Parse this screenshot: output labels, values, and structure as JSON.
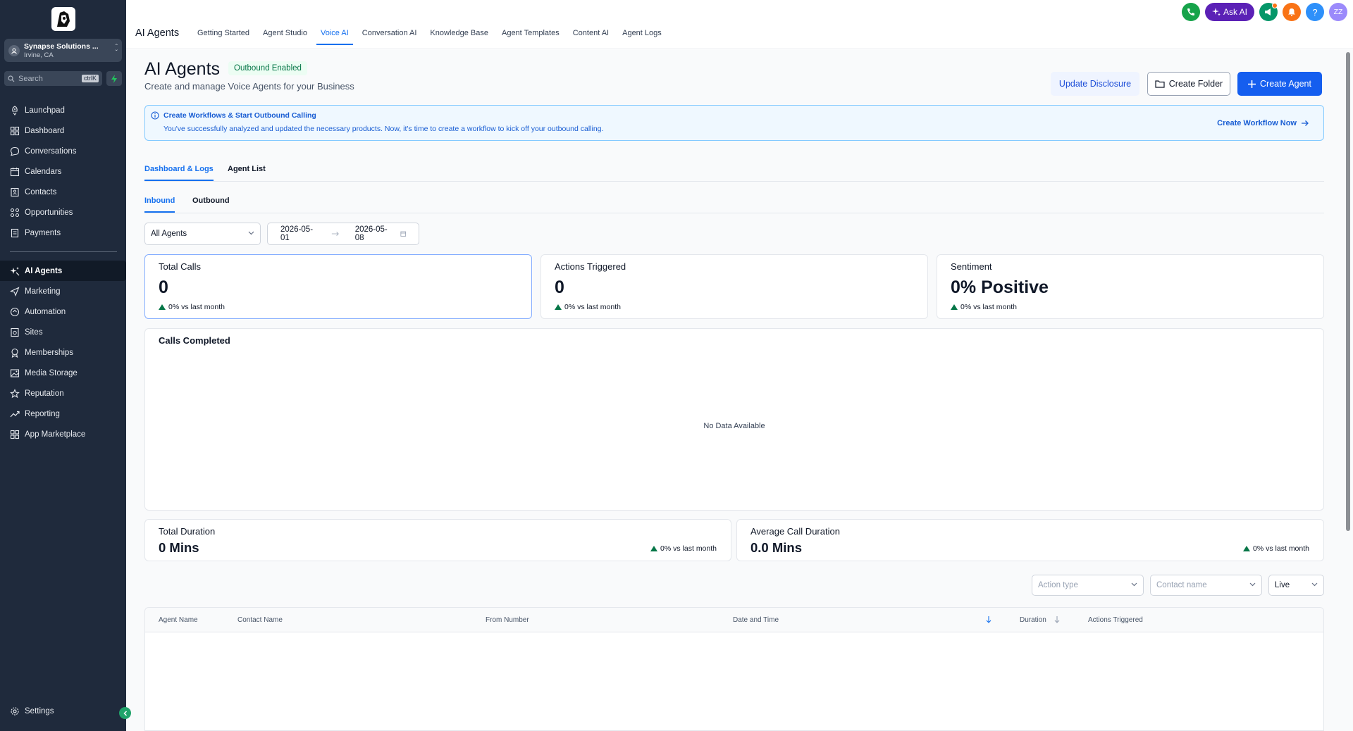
{
  "sidebar": {
    "account": {
      "name": "Synapse Solutions ...",
      "location": "Irvine, CA"
    },
    "search": {
      "placeholder": "Search",
      "shortcut": "ctrlK"
    },
    "items_top": [
      {
        "label": "Launchpad",
        "icon": "rocket-icon"
      },
      {
        "label": "Dashboard",
        "icon": "grid-icon"
      },
      {
        "label": "Conversations",
        "icon": "chat-icon"
      },
      {
        "label": "Calendars",
        "icon": "calendar-icon"
      },
      {
        "label": "Contacts",
        "icon": "contacts-icon"
      },
      {
        "label": "Opportunities",
        "icon": "opportunities-icon"
      },
      {
        "label": "Payments",
        "icon": "payments-icon"
      }
    ],
    "items_bottom": [
      {
        "label": "AI Agents",
        "icon": "sparkle-icon",
        "active": true
      },
      {
        "label": "Marketing",
        "icon": "send-icon"
      },
      {
        "label": "Automation",
        "icon": "automation-icon"
      },
      {
        "label": "Sites",
        "icon": "sites-icon"
      },
      {
        "label": "Memberships",
        "icon": "badge-icon"
      },
      {
        "label": "Media Storage",
        "icon": "image-icon"
      },
      {
        "label": "Reputation",
        "icon": "star-icon"
      },
      {
        "label": "Reporting",
        "icon": "trend-icon"
      },
      {
        "label": "App Marketplace",
        "icon": "apps-icon"
      }
    ],
    "settings": "Settings"
  },
  "topbar": {
    "title": "AI Agents",
    "tabs": [
      {
        "label": "Getting Started"
      },
      {
        "label": "Agent Studio"
      },
      {
        "label": "Voice AI",
        "active": true
      },
      {
        "label": "Conversation AI"
      },
      {
        "label": "Knowledge Base"
      },
      {
        "label": "Agent Templates"
      },
      {
        "label": "Content AI"
      },
      {
        "label": "Agent Logs"
      }
    ],
    "ask_ai": "Ask AI",
    "avatar": "ZZ",
    "help": "?"
  },
  "page": {
    "title": "AI Agents",
    "badge": "Outbound Enabled",
    "subtitle": "Create and manage Voice Agents for your Business",
    "btn_update": "Update Disclosure",
    "btn_folder": "Create Folder",
    "btn_create": "Create Agent"
  },
  "alert": {
    "title": "Create Workflows & Start Outbound Calling",
    "desc": "You've successfully analyzed and updated the necessary products. Now, it's time to create a workflow to kick off your outbound calling.",
    "link": "Create Workflow Now"
  },
  "subtabs": [
    "Dashboard & Logs",
    "Agent List"
  ],
  "direction_tabs": [
    "Inbound",
    "Outbound"
  ],
  "filters": {
    "agent": "All Agents",
    "date_from": "2026-05-01",
    "date_to": "2026-05-08"
  },
  "stats": {
    "total_calls": {
      "label": "Total Calls",
      "value": "0",
      "trend": "0% vs last month"
    },
    "actions": {
      "label": "Actions Triggered",
      "value": "0",
      "trend": "0% vs last month"
    },
    "sentiment": {
      "label": "Sentiment",
      "value": "0% Positive",
      "trend": "0% vs last month"
    }
  },
  "calls_completed": {
    "title": "Calls Completed",
    "empty": "No Data Available"
  },
  "durations": {
    "total": {
      "label": "Total Duration",
      "value": "0 Mins",
      "trend": "0% vs last month"
    },
    "average": {
      "label": "Average Call Duration",
      "value": "0.0 Mins",
      "trend": "0% vs last month"
    }
  },
  "log_filters": {
    "action_type": "Action type",
    "contact_name": "Contact name",
    "mode": "Live"
  },
  "table": {
    "columns": [
      "Agent Name",
      "Contact Name",
      "From Number",
      "Date and Time",
      "Duration",
      "Actions Triggered"
    ]
  },
  "colors": {
    "sidebar_bg": "#1f2a3c",
    "accent": "#155eef",
    "link": "#1570ef",
    "positive": "#067647"
  }
}
